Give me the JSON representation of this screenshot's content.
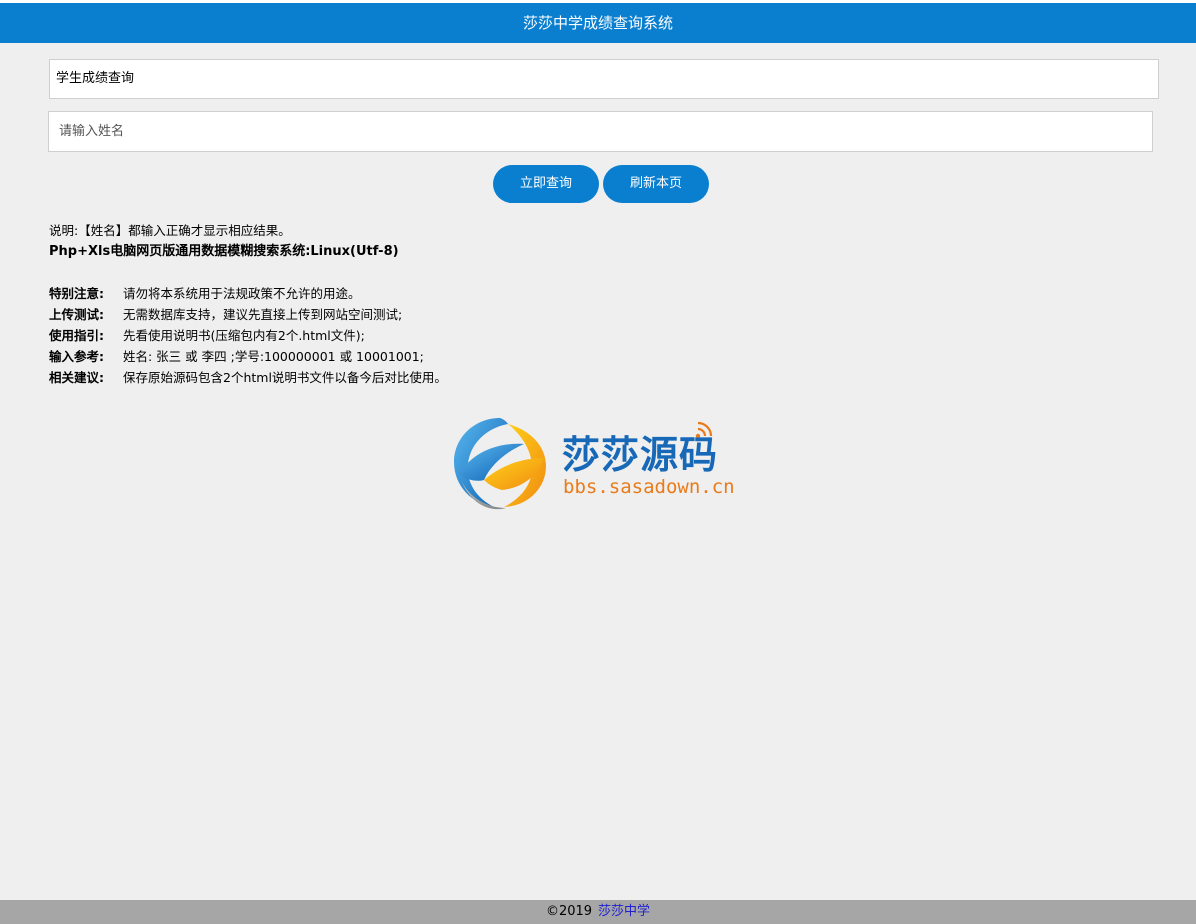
{
  "header": {
    "title": "莎莎中学成绩查询系统"
  },
  "form": {
    "section_title": "学生成绩查询",
    "name_placeholder": "请输入姓名",
    "query_button": "立即查询",
    "refresh_button": "刷新本页"
  },
  "info": {
    "note": "说明:【姓名】都输入正确才显示相应结果。",
    "system": "Php+Xls电脑网页版通用数据模糊搜索系统:Linux(Utf-8)",
    "items": [
      {
        "label": "特别注意:",
        "text": "请勿将本系统用于法规政策不允许的用途。"
      },
      {
        "label": "上传测试:",
        "text": "无需数据库支持，建议先直接上传到网站空间测试;"
      },
      {
        "label": "使用指引:",
        "text": "先看使用说明书(压缩包内有2个.html文件);"
      },
      {
        "label": "输入参考:",
        "text": "姓名: 张三 或 李四 ;学号:100000001 或 10001001;"
      },
      {
        "label": "相关建议:",
        "text": "保存原始源码包含2个html说明书文件以备今后对比使用。"
      }
    ]
  },
  "logo": {
    "name": "莎莎源码",
    "url": "bbs.sasadown.cn"
  },
  "footer": {
    "copyright": "©2019",
    "link": "莎莎中学"
  },
  "colors": {
    "primary": "#0a7fd0",
    "background": "#efefef",
    "footer": "#a6a6a6",
    "link": "#1f1fd1"
  }
}
